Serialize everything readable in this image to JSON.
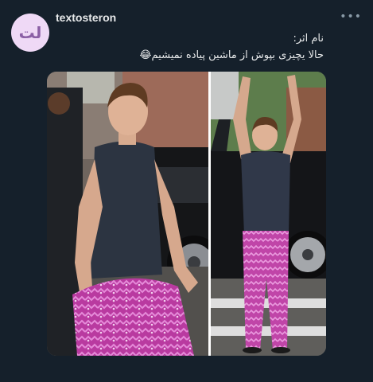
{
  "account": {
    "username": "textosteron",
    "avatar_glyph": "لت",
    "avatar_color": "#efd9f6"
  },
  "more_icon": "more-horizontal-icon",
  "more_glyph": "•••",
  "tweet": {
    "line1": "نام اثر:",
    "line2": "حالا یچیزی بپوش از ماشین پیاده نمیشیم😂"
  },
  "media": {
    "description_icon": "photo"
  },
  "colors": {
    "background": "#15202b",
    "text": "#e7e9ea",
    "muted": "#8899a6"
  }
}
